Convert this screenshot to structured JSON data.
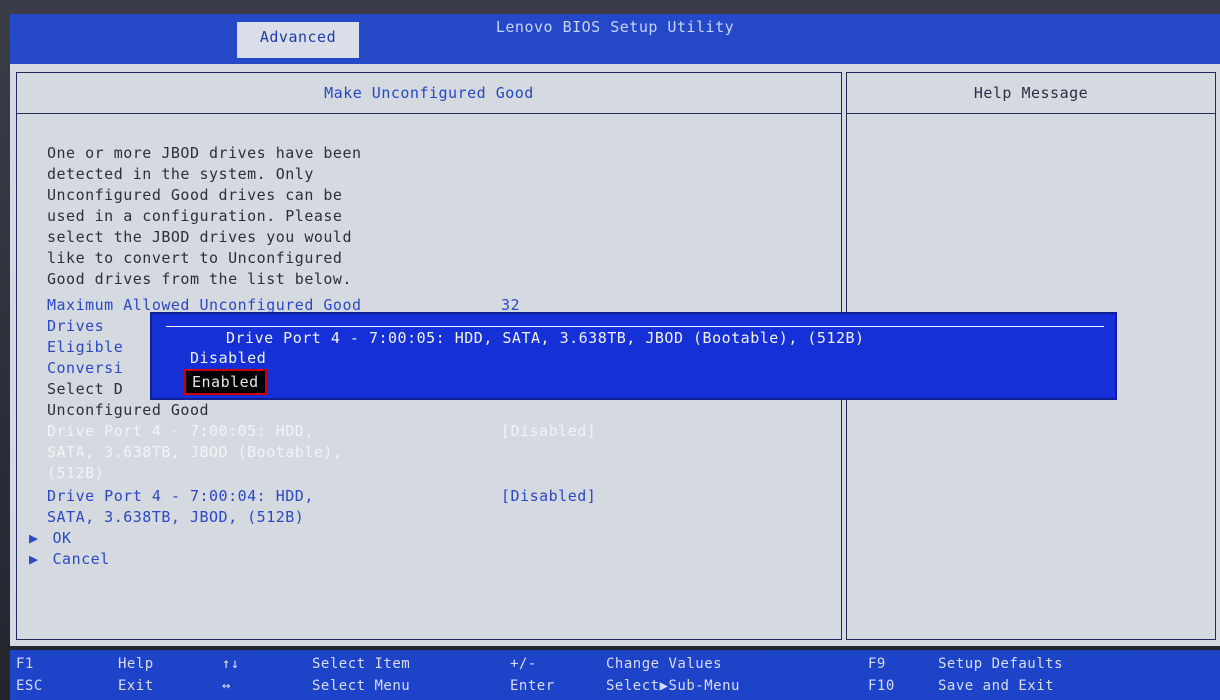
{
  "window": {
    "title": "Lenovo BIOS Setup Utility",
    "active_tab": "Advanced"
  },
  "main_panel": {
    "title": "Make Unconfigured Good",
    "description": [
      "One or more JBOD drives have been",
      "detected in the system. Only",
      "Unconfigured Good drives can be",
      "used in a configuration. Please",
      "select the JBOD drives you would",
      "like to convert to Unconfigured",
      "Good drives from the list below."
    ],
    "max_allowed": {
      "label_line1": "Maximum Allowed Unconfigured Good",
      "label_line2": "Drives",
      "value": "32"
    },
    "eligible_prefix": "Eligible",
    "conversion_prefix": "Conversi",
    "select_prefix": "Select D",
    "unconfigured_good": "Unconfigured Good",
    "drive1": {
      "line1": "Drive Port 4 - 7:00:05: HDD,",
      "line2": "SATA, 3.638TB, JBOD (Bootable),",
      "line3": "(512B)",
      "value": "[Disabled]"
    },
    "drive2": {
      "line1": "Drive Port 4 - 7:00:04: HDD,",
      "line2": "SATA, 3.638TB, JBOD, (512B)",
      "value": "[Disabled]"
    },
    "actions": [
      {
        "label": "OK"
      },
      {
        "label": "Cancel"
      }
    ]
  },
  "popup": {
    "title": "Drive Port 4 - 7:00:05: HDD, SATA, 3.638TB, JBOD (Bootable), (512B)",
    "options": [
      "Disabled",
      "Enabled"
    ],
    "selected": "Enabled"
  },
  "help_panel": {
    "title": "Help Message"
  },
  "footer": {
    "items": [
      {
        "key": "F1",
        "label": "Help"
      },
      {
        "key": "ESC",
        "label": "Exit"
      },
      {
        "key": "↑↓",
        "label": "Select Item"
      },
      {
        "key": "↔",
        "label": "Select Menu"
      },
      {
        "key": "+/-",
        "label": "Change Values"
      },
      {
        "key": "Enter",
        "label": "Select▶Sub-Menu"
      },
      {
        "key": "F9",
        "label": "Setup Defaults"
      },
      {
        "key": "F10",
        "label": "Save and Exit"
      }
    ]
  }
}
